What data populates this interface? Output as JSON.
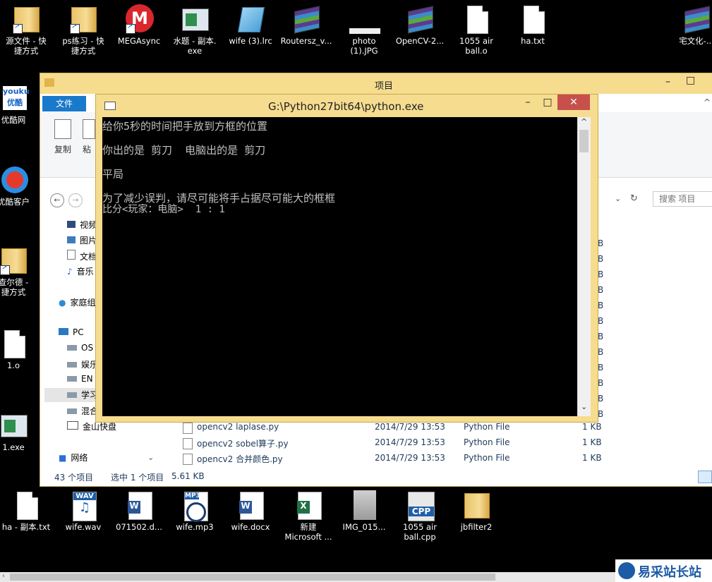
{
  "desktop_top": [
    {
      "label": "源文件 - 快\n捷方式",
      "icon": "folder-shortcut-icon"
    },
    {
      "label": "ps练习 - 快\n捷方式",
      "icon": "folder-shortcut-icon"
    },
    {
      "label": "MEGAsync",
      "icon": "mega-icon"
    },
    {
      "label": "水题 - 副本.\nexe",
      "icon": "exe-icon"
    },
    {
      "label": "wife (3).lrc",
      "icon": "notepad-icon"
    },
    {
      "label": "Routersz_v...",
      "icon": "winrar-icon"
    },
    {
      "label": "photo\n(1).JPG",
      "icon": "image-icon"
    },
    {
      "label": "OpenCV-2...",
      "icon": "winrar-icon"
    },
    {
      "label": "1055 air\nball.o",
      "icon": "file-icon"
    },
    {
      "label": "ha.txt",
      "icon": "text-file-icon"
    },
    {
      "label": "宅文化-...",
      "icon": "winrar-icon"
    }
  ],
  "desktop_left": [
    {
      "label": "优酷网",
      "icon": "youku-icon"
    },
    {
      "label": "优酷客户",
      "icon": "youku-client-icon"
    },
    {
      "label": "查尔德 -\n捷方式",
      "icon": "folder-shortcut-icon"
    },
    {
      "label": "1.o",
      "icon": "file-icon"
    },
    {
      "label": "1.exe",
      "icon": "exe-icon"
    }
  ],
  "desktop_bottom": [
    {
      "label": "ha - 副本.txt",
      "icon": "text-file-icon"
    },
    {
      "label": "wife.wav",
      "icon": "wav-icon",
      "badge": "WAV"
    },
    {
      "label": "071502.d...",
      "icon": "word-icon"
    },
    {
      "label": "wife.mp3",
      "icon": "mp3-icon",
      "badge": "MP3"
    },
    {
      "label": "wife.docx",
      "icon": "word-icon"
    },
    {
      "label": "新建\nMicrosoft ...",
      "icon": "excel-icon"
    },
    {
      "label": "IMG_015...",
      "icon": "image-icon"
    },
    {
      "label": "1055 air\nball.cpp",
      "icon": "cpp-icon",
      "badge": "CPP"
    },
    {
      "label": "jbfilter2",
      "icon": "folder-icon"
    }
  ],
  "explorer": {
    "title": "项目",
    "file_tab": "文件",
    "ribbon_copy": "复制",
    "ribbon_paste": "粘",
    "search_placeholder": "搜索 项目",
    "nav_items": [
      "视频",
      "图片",
      "文档",
      "音乐",
      "家庭组",
      "PC",
      "OS",
      "娱乐",
      "EN",
      "学习",
      "混合",
      "金山快盘",
      "网络"
    ],
    "size_col": [
      "B",
      "B",
      "B",
      "B",
      "B",
      "B",
      "B",
      "B",
      "B",
      "B",
      "B",
      "B"
    ],
    "files": [
      {
        "name": "opencv2 laplase.py",
        "date": "2014/7/29 13:53",
        "type": "Python File",
        "size": "1 KB"
      },
      {
        "name": "opencv2 sobel算子.py",
        "date": "2014/7/29 13:53",
        "type": "Python File",
        "size": "1 KB"
      },
      {
        "name": "opencv2 合并颜色.py",
        "date": "2014/7/29 13:53",
        "type": "Python File",
        "size": "1 KB"
      }
    ],
    "status_count": "43 个项目",
    "status_selected": "选中 1 个项目",
    "status_size": "5.61 KB"
  },
  "console": {
    "title": "G:\\Python27bit64\\python.exe",
    "minimize": "–",
    "maximize": "□",
    "close": "✕",
    "lines": [
      "给你5秒的时间把手放到方框的位置",
      "你出的是 剪刀  电脑出的是 剪刀",
      "平局",
      "为了减少误判，请尽可能将手占据尽可能大的框框",
      "比分<玩家：电脑>  1 : 1"
    ]
  },
  "watermark": "易采站长站",
  "colors": {
    "titlebar": "#f6dc8f",
    "accent": "#1979ca",
    "close": "#c7504c",
    "console_bg": "#000000",
    "console_text": "#c0c0c0"
  }
}
